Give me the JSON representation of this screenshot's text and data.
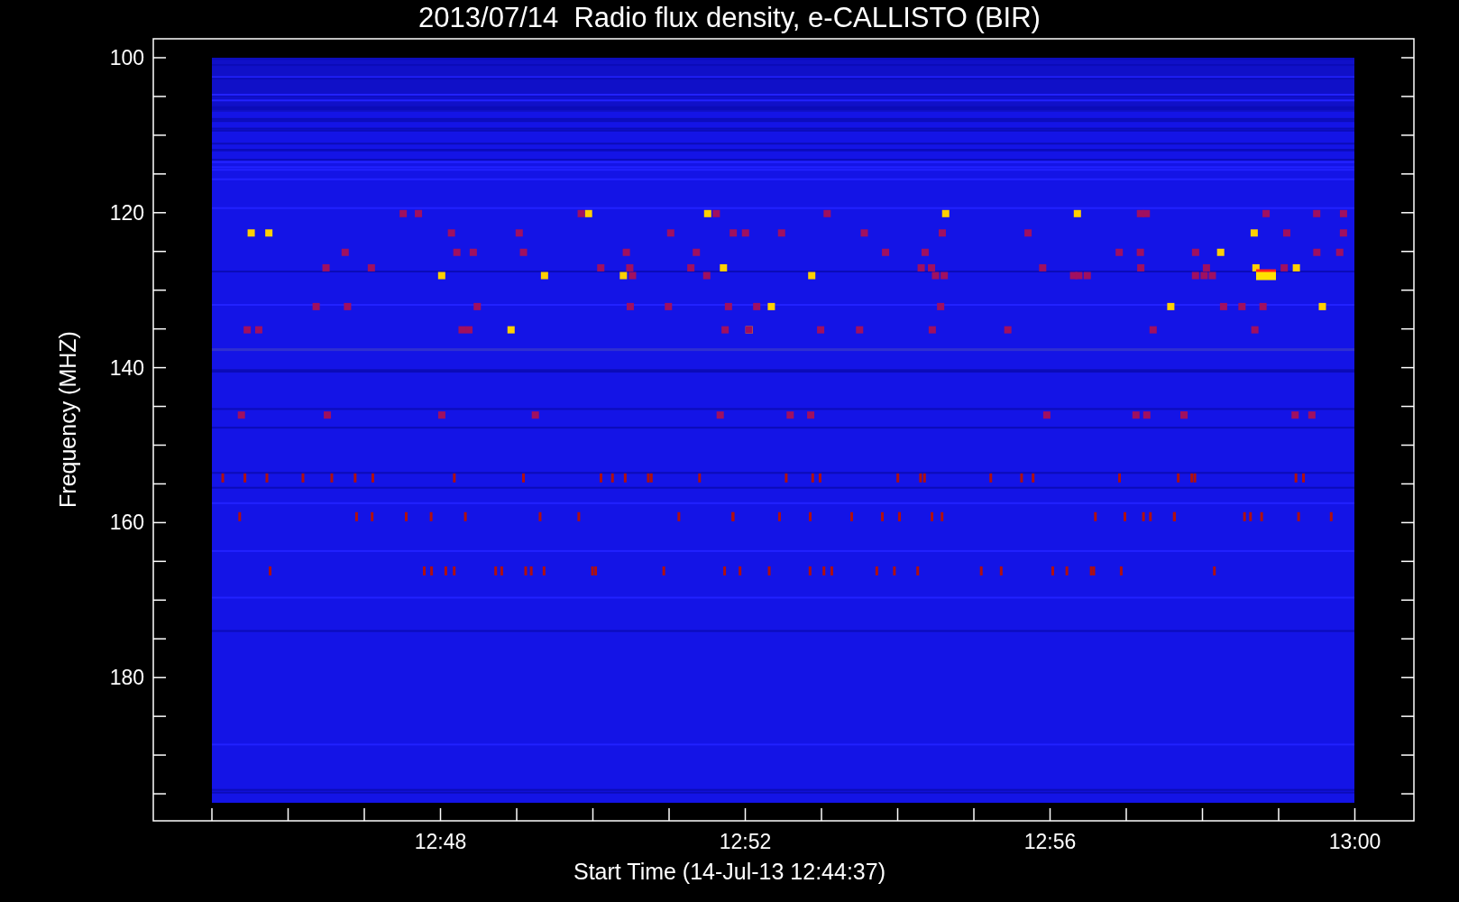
{
  "plot": {
    "title": "2013/07/14  Radio flux density, e-CALLISTO (BIR)",
    "ylabel": "Frequency (MHZ)",
    "xlabel": "Start Time (14-Jul-13 12:44:37)",
    "yticks": [
      "100",
      "120",
      "140",
      "160",
      "180"
    ],
    "xticks": [
      "12:48",
      "12:52",
      "12:56",
      "13:00"
    ]
  }
}
